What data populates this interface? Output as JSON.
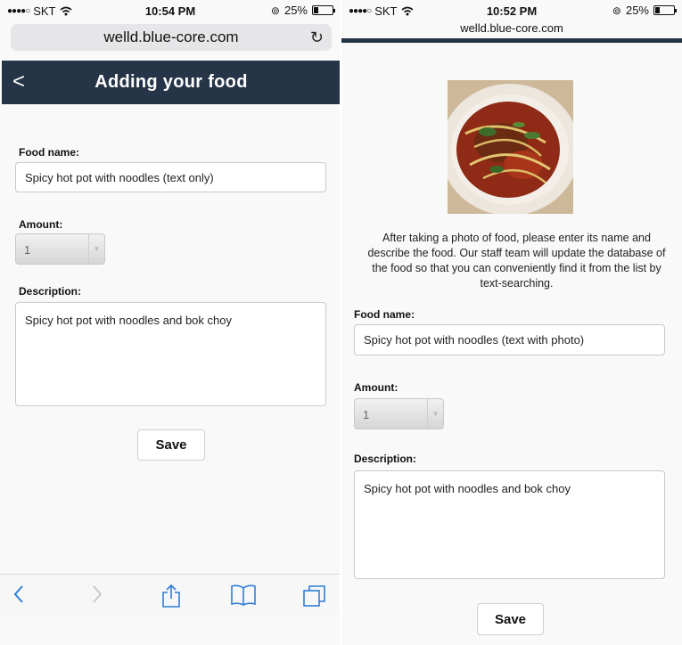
{
  "left_screen": {
    "status": {
      "carrier": "SKT",
      "time": "10:54 PM",
      "battery": "25%",
      "battery_level": 0.25
    },
    "url": "welld.blue-core.com",
    "header": {
      "back_label": "<",
      "title": "Adding your food"
    },
    "form": {
      "food_name_label": "Food name:",
      "food_name_value": "Spicy hot pot with noodles (text only)",
      "amount_label": "Amount:",
      "amount_value": "1",
      "description_label": "Description:",
      "description_value": "Spicy hot pot with noodles and bok choy",
      "save_label": "Save"
    },
    "toolbar": [
      "back-icon",
      "forward-icon",
      "share-icon",
      "bookmarks-icon",
      "tabs-icon"
    ]
  },
  "right_screen": {
    "status": {
      "carrier": "SKT",
      "time": "10:52 PM",
      "battery": "25%",
      "battery_level": 0.25
    },
    "url": "welld.blue-core.com",
    "instructions": "After taking a photo of food, please enter its name and describe the food. Our staff team will update the database of the food so that you can conveniently find it from the list by text-searching.",
    "form": {
      "food_name_label": "Food name:",
      "food_name_value": "Spicy hot pot with noodles (text with photo)",
      "amount_label": "Amount:",
      "amount_value": "1",
      "description_label": "Description:",
      "description_value": "Spicy hot pot with noodles and bok choy",
      "save_label": "Save"
    }
  },
  "colors": {
    "header_bg": "#253447",
    "toolbar_icon": "#2f7fd4",
    "page_bg": "#f9f9f9"
  }
}
